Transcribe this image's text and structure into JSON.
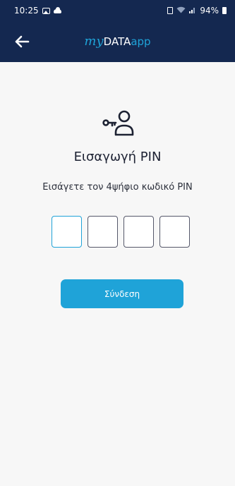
{
  "status_bar": {
    "time": "10:25",
    "battery": "94%",
    "icons": [
      "photo-icon",
      "cloud-icon",
      "sim-icon",
      "wifi-icon",
      "signal-icon",
      "battery-icon"
    ]
  },
  "app_bar": {
    "back_icon": "arrow-left-icon",
    "brand": {
      "my": "my",
      "data": "DATA",
      "app": "app"
    }
  },
  "main": {
    "icon": "key-user-icon",
    "title": "Εισαγωγή PIN",
    "subtitle": "Εισάγετε τον 4ψήφιο κωδικό PIN",
    "pin_digits": [
      "",
      "",
      "",
      ""
    ],
    "active_digit_index": 0,
    "login_label": "Σύνδεση"
  },
  "colors": {
    "header_bg": "#142850",
    "accent": "#1fa3d8",
    "background": "#f7f7f7",
    "text": "#1d2233"
  }
}
